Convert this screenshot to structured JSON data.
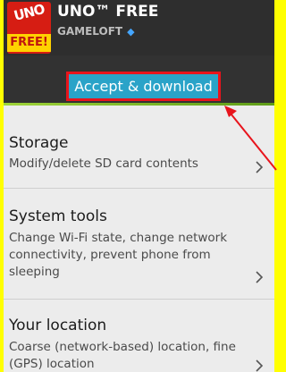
{
  "app": {
    "title": "UNO™ FREE",
    "publisher": "GAMELOFT",
    "icon_text_top": "UNO",
    "icon_text_bottom": "FREE!"
  },
  "accept_button_label": "Accept & download",
  "permissions": [
    {
      "title": "Storage",
      "description": "Modify/delete SD card contents"
    },
    {
      "title": "System tools",
      "description": "Change Wi-Fi state, change network connectivity, prevent phone from sleeping"
    },
    {
      "title": "Your location",
      "description": "Coarse (network-based) location, fine (GPS) location"
    }
  ],
  "colors": {
    "frame_border": "#ffff00",
    "accept_button": "#2aa3c8",
    "highlight": "#e8141c",
    "accent_green": "#7cc02a"
  }
}
